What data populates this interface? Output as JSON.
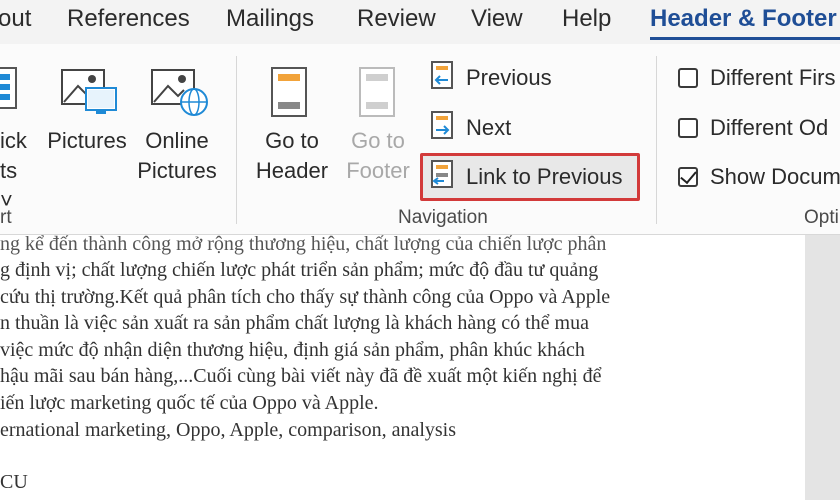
{
  "tabs": [
    {
      "label": "out",
      "active": false
    },
    {
      "label": "References",
      "active": false
    },
    {
      "label": "Mailings",
      "active": false
    },
    {
      "label": "Review",
      "active": false
    },
    {
      "label": "View",
      "active": false
    },
    {
      "label": "Help",
      "active": false
    },
    {
      "label": "Header & Footer",
      "active": true
    }
  ],
  "insert_group": {
    "quick_parts": {
      "line1": "ick",
      "line2": "ts ˅"
    },
    "pictures": "Pictures",
    "online_pictures": {
      "line1": "Online",
      "line2": "Pictures"
    },
    "label": "rt"
  },
  "navigation_group": {
    "go_to_header": {
      "line1": "Go to",
      "line2": "Header"
    },
    "go_to_footer": {
      "line1": "Go to",
      "line2": "Footer",
      "disabled": true
    },
    "previous": "Previous",
    "next": "Next",
    "link_to_previous": "Link to Previous",
    "label": "Navigation"
  },
  "options_group": {
    "different_first": {
      "label": "Different Firs",
      "checked": false
    },
    "different_odd": {
      "label": "Different Od",
      "checked": false
    },
    "show_document": {
      "label": "Show Docum",
      "checked": true
    },
    "label": "Opti"
  },
  "document_lines": [
    "ng kể đến thành công mở rộng thương hiệu, chất lượng của chiến lược phân",
    "g định vị; chất lượng chiến lược phát triển sản phẩm; mức độ đầu tư quảng",
    " cứu thị trường.Kết quả phân tích cho thấy sự thành công của Oppo và Apple",
    "n thuần là việc sản xuất ra sản phẩm chất lượng là khách hàng có thể mua",
    " việc mức độ nhận diện thương hiệu, định giá sản phẩm, phân khúc khách",
    "hậu mãi sau bán hàng,...Cuối cùng bài viết này đã đề xuất một kiến nghị để",
    "iến lược marketing quốc tế của Oppo và Apple.",
    "ernational marketing, Oppo, Apple, comparison, analysis",
    "",
    "CU"
  ],
  "colors": {
    "accent": "#1f4e96",
    "highlight_border": "#d23a3a",
    "icon_orange": "#f2a33a",
    "icon_blue": "#1f8ad6"
  }
}
